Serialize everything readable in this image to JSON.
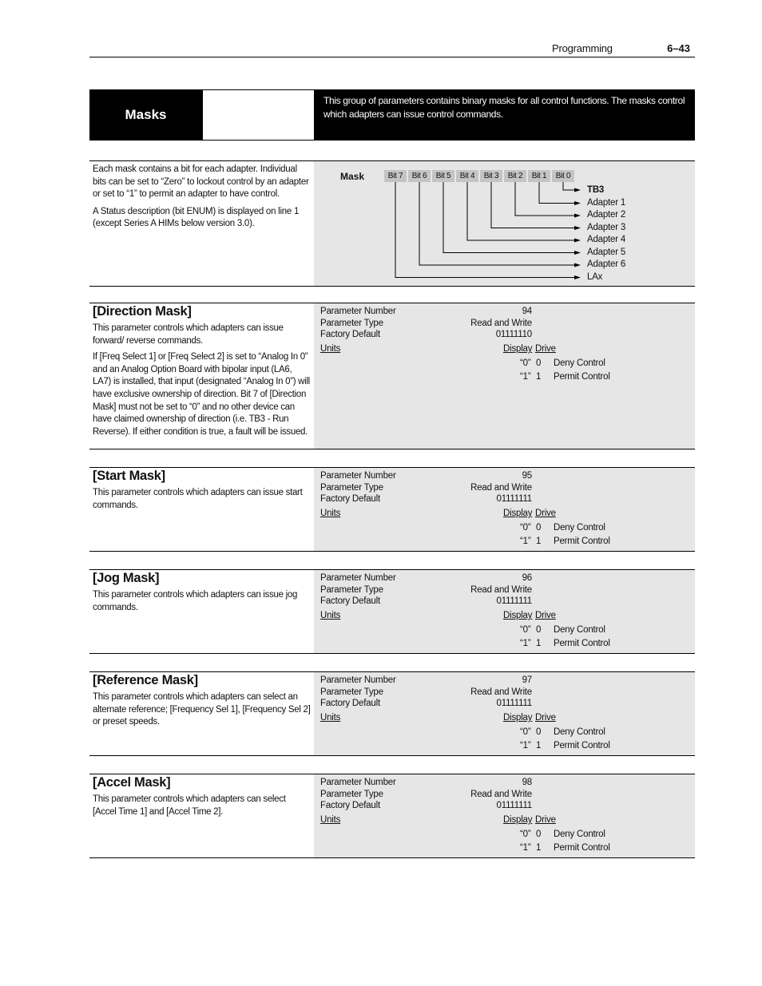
{
  "header": {
    "section": "Programming",
    "page_number": "6–43"
  },
  "banner": {
    "title": "Masks",
    "description": "This group of parameters contains binary masks for all control functions. The masks control which adapters can issue control commands."
  },
  "intro": {
    "paragraphs": [
      "Each mask contains a bit for each adapter. Individual bits can be set to “Zero” to lockout control by an adapter or set to “1” to permit an adapter to have control.",
      "A Status description (bit ENUM) is displayed on line 1 (except Series A HIMs below version 3.0)."
    ],
    "diagram": {
      "label": "Mask",
      "bits": [
        "Bit 7",
        "Bit 6",
        "Bit 5",
        "Bit 4",
        "Bit 3",
        "Bit 2",
        "Bit 1",
        "Bit 0"
      ],
      "targets": [
        "TB3",
        "Adapter 1",
        "Adapter 2",
        "Adapter 3",
        "Adapter 4",
        "Adapter 5",
        "Adapter 6",
        "LAx"
      ]
    }
  },
  "labels": {
    "parameter_number": "Parameter Number",
    "parameter_type": "Parameter Type",
    "factory_default": "Factory Default",
    "units": "Units",
    "display": "Display",
    "drive": "Drive"
  },
  "parameters": [
    {
      "name": "[Direction Mask]",
      "description": [
        "This parameter controls which adapters can issue forward/ reverse commands.",
        "If [Freq Select 1] or [Freq Select 2] is set to “Analog In 0” and an Analog Option Board with bipolar input (LA6, LA7) is installed, that input (designated “Analog In 0”) will have exclusive ownership of direction. Bit 7 of [Direction Mask] must not be set to “0” and no other device can have claimed ownership of direction (i.e. TB3 - Run Reverse). If either condition is true, a fault will be issued."
      ],
      "number": "94",
      "type": "Read and Write",
      "default": "01111110",
      "enums": [
        {
          "display": "“0”",
          "drive": "0",
          "text": "Deny Control"
        },
        {
          "display": "“1”",
          "drive": "1",
          "text": "Permit Control"
        }
      ]
    },
    {
      "name": "[Start Mask]",
      "description": [
        "This parameter controls which adapters can issue start commands."
      ],
      "number": "95",
      "type": "Read and Write",
      "default": "01111111",
      "enums": [
        {
          "display": "“0”",
          "drive": "0",
          "text": "Deny Control"
        },
        {
          "display": "“1”",
          "drive": "1",
          "text": "Permit Control"
        }
      ]
    },
    {
      "name": "[Jog Mask]",
      "description": [
        "This parameter controls which adapters can issue jog commands."
      ],
      "number": "96",
      "type": "Read and Write",
      "default": "01111111",
      "enums": [
        {
          "display": "“0”",
          "drive": "0",
          "text": "Deny Control"
        },
        {
          "display": "“1”",
          "drive": "1",
          "text": "Permit Control"
        }
      ]
    },
    {
      "name": "[Reference Mask]",
      "description": [
        "This parameter controls which adapters can select an alternate reference; [Frequency Sel 1], [Frequency Sel 2] or preset speeds."
      ],
      "number": "97",
      "type": "Read and Write",
      "default": "01111111",
      "enums": [
        {
          "display": "“0”",
          "drive": "0",
          "text": "Deny Control"
        },
        {
          "display": "“1”",
          "drive": "1",
          "text": "Permit Control"
        }
      ]
    },
    {
      "name": "[Accel Mask]",
      "description": [
        "This parameter controls which adapters can select [Accel Time 1] and [Accel Time 2]."
      ],
      "number": "98",
      "type": "Read and Write",
      "default": "01111111",
      "enums": [
        {
          "display": "“0”",
          "drive": "0",
          "text": "Deny Control"
        },
        {
          "display": "“1”",
          "drive": "1",
          "text": "Permit Control"
        }
      ]
    }
  ]
}
